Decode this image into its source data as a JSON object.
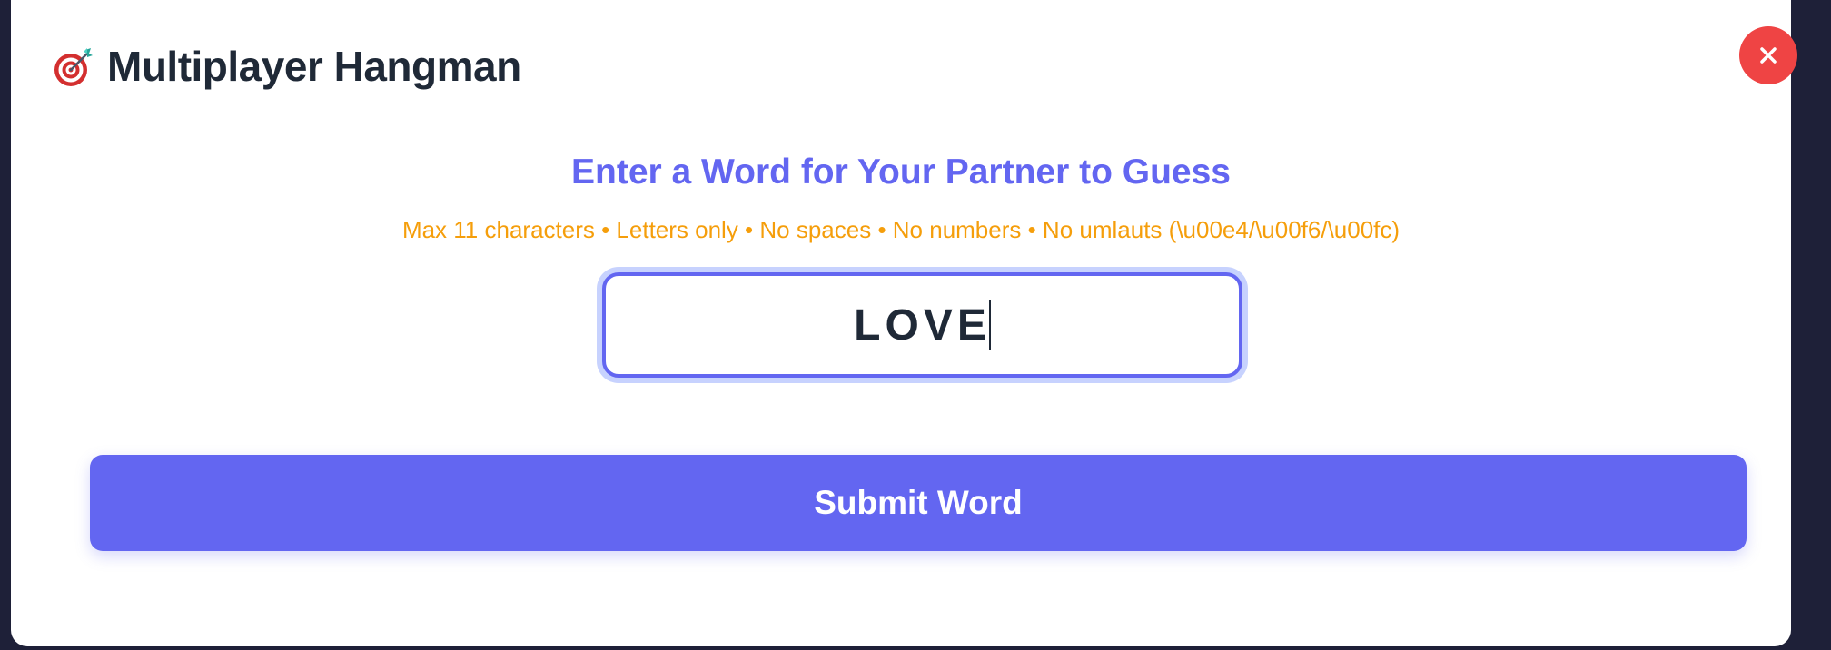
{
  "header": {
    "icon": "dart-target-icon",
    "title": "Multiplayer Hangman"
  },
  "close_button": {
    "icon": "close-icon",
    "color": "#ef4444"
  },
  "prompt": {
    "title": "Enter a Word for Your Partner to Guess",
    "rules": "Max 11 characters • Letters only • No spaces • No numbers • No umlauts (\\u00e4/\\u00f6/\\u00fc)"
  },
  "word_input": {
    "value": "LOVE",
    "placeholder": ""
  },
  "submit": {
    "label": "Submit Word"
  },
  "colors": {
    "accent": "#6366f1",
    "warning": "#f59e0b",
    "danger": "#ef4444",
    "text": "#1f2937"
  }
}
